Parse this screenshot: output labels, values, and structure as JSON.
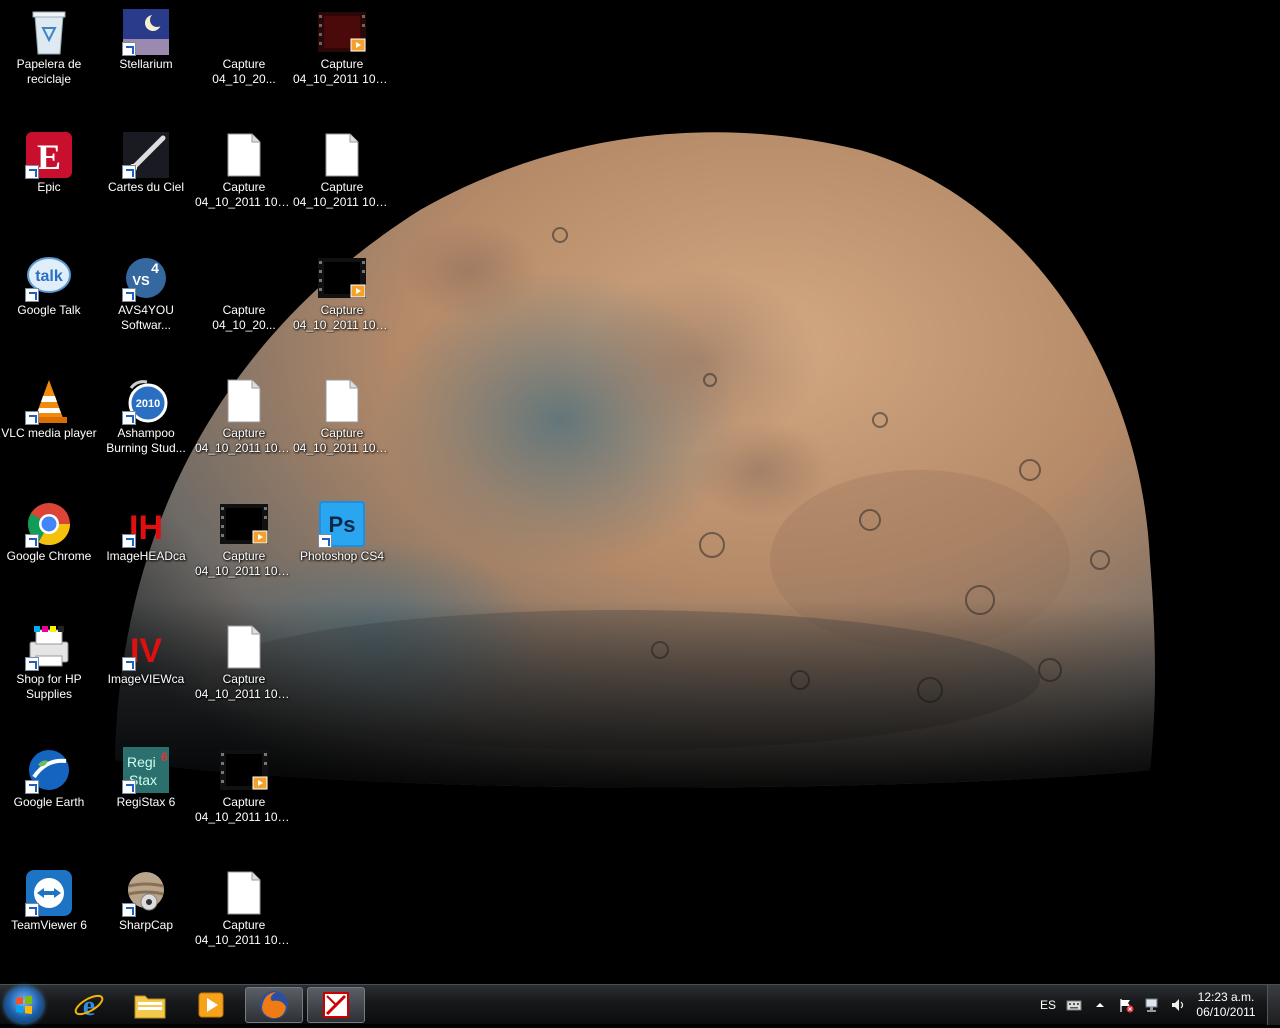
{
  "desktop": {
    "icons": [
      {
        "id": "recycle-bin",
        "line1": "Papelera de",
        "line2": "reciclaje"
      },
      {
        "id": "stellarium",
        "line1": "Stellarium",
        "line2": ""
      },
      {
        "id": "capture-1",
        "line1": "Capture",
        "line2": "04_10_20..."
      },
      {
        "id": "capture-2",
        "line1": "Capture",
        "line2": "04_10_2011 10_3..."
      },
      {
        "id": "epic",
        "line1": "Epic",
        "line2": ""
      },
      {
        "id": "cartes-du-ciel",
        "line1": "Cartes du Ciel",
        "line2": ""
      },
      {
        "id": "capture-3",
        "line1": "Capture",
        "line2": "04_10_2011 10_1..."
      },
      {
        "id": "capture-4",
        "line1": "Capture",
        "line2": "04_10_2011 10_3..."
      },
      {
        "id": "google-talk",
        "line1": "Google Talk",
        "line2": ""
      },
      {
        "id": "avs4you",
        "line1": "AVS4YOU",
        "line2": "Softwar..."
      },
      {
        "id": "capture-5",
        "line1": "Capture",
        "line2": "04_10_20..."
      },
      {
        "id": "capture-6",
        "line1": "Capture",
        "line2": "04_10_2011 10_3..."
      },
      {
        "id": "vlc",
        "line1": "VLC media player",
        "line2": ""
      },
      {
        "id": "ashampoo",
        "line1": "Ashampoo",
        "line2": "Burning Stud..."
      },
      {
        "id": "capture-7",
        "line1": "Capture",
        "line2": "04_10_2011 10_1..."
      },
      {
        "id": "capture-8",
        "line1": "Capture",
        "line2": "04_10_2011 10_3..."
      },
      {
        "id": "google-chrome",
        "line1": "Google Chrome",
        "line2": ""
      },
      {
        "id": "imagehead",
        "line1": "ImageHEADca",
        "line2": ""
      },
      {
        "id": "capture-9",
        "line1": "Capture",
        "line2": "04_10_2011 10_1..."
      },
      {
        "id": "photoshop",
        "line1": "Photoshop CS4",
        "line2": ""
      },
      {
        "id": "hp-supplies",
        "line1": "Shop for HP",
        "line2": "Supplies"
      },
      {
        "id": "imageview",
        "line1": "ImageVIEWca",
        "line2": ""
      },
      {
        "id": "capture-10",
        "line1": "Capture",
        "line2": "04_10_2011 10_1..."
      },
      {
        "id": "google-earth",
        "line1": "Google Earth",
        "line2": ""
      },
      {
        "id": "registax",
        "line1": "RegiStax 6",
        "line2": ""
      },
      {
        "id": "capture-11",
        "line1": "Capture",
        "line2": "04_10_2011 10_1..."
      },
      {
        "id": "teamviewer",
        "line1": "TeamViewer 6",
        "line2": ""
      },
      {
        "id": "sharpcap",
        "line1": "SharpCap",
        "line2": ""
      },
      {
        "id": "capture-12",
        "line1": "Capture",
        "line2": "04_10_2011 10_1..."
      }
    ]
  },
  "taskbar": {
    "pinned": [
      "internet-explorer",
      "windows-explorer",
      "windows-media-player",
      "firefox",
      "capture-app"
    ],
    "tray": {
      "language": "ES",
      "time": "12:23 a.m.",
      "date": "06/10/2011"
    }
  },
  "colors": {
    "taskbar": "#16181a",
    "moon_light": "#c8a07a",
    "moon_dark": "#5d6a72"
  }
}
